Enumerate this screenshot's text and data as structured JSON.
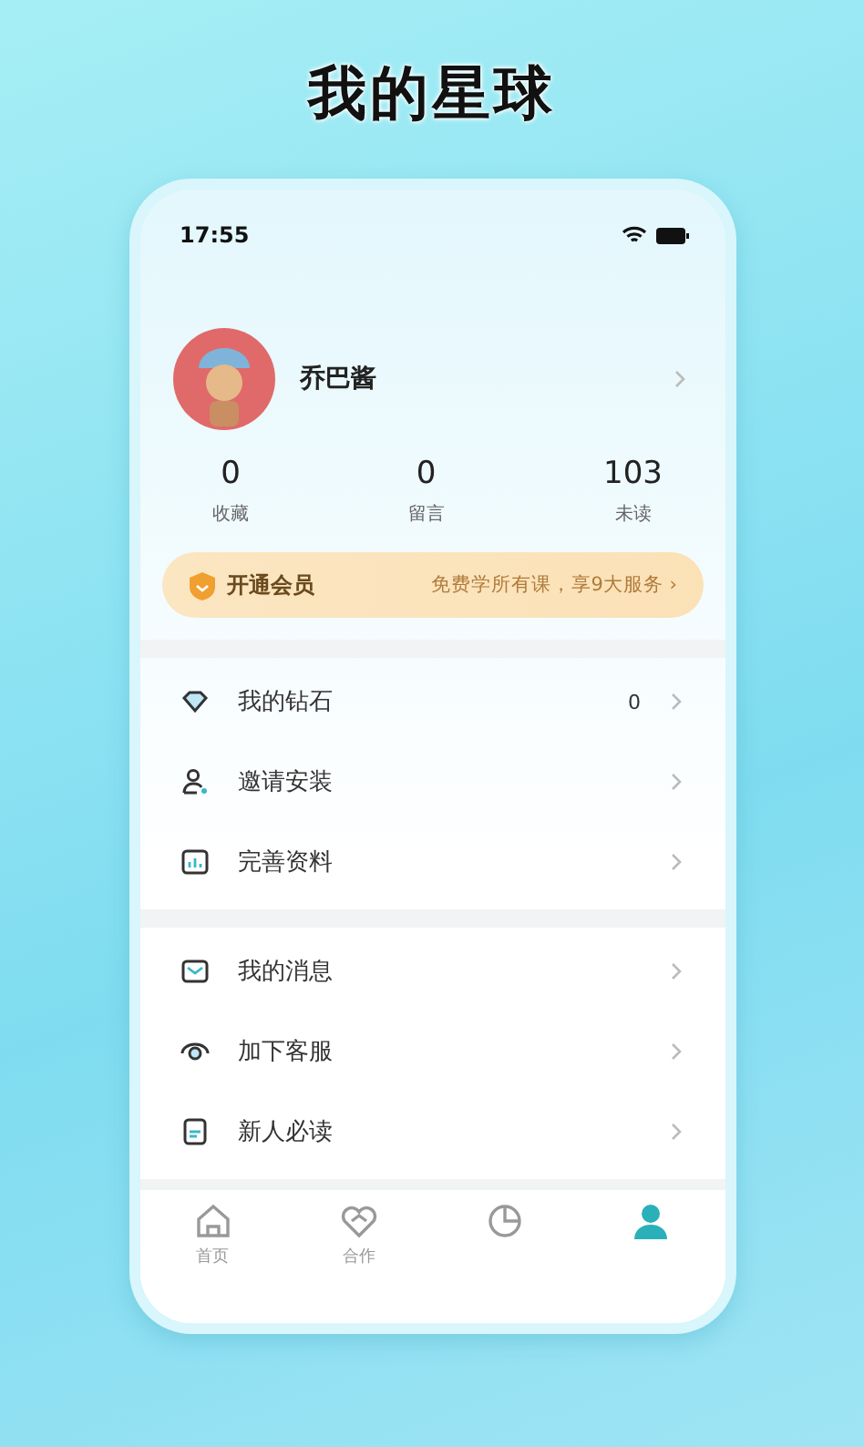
{
  "headline": "我的星球",
  "status_bar": {
    "time": "17:55"
  },
  "profile": {
    "name": "乔巴酱"
  },
  "stats": [
    {
      "value": "0",
      "label": "收藏"
    },
    {
      "value": "0",
      "label": "留言"
    },
    {
      "value": "103",
      "label": "未读"
    }
  ],
  "vip_banner": {
    "title": "开通会员",
    "subtitle": "免费学所有课，享9大服务 ›"
  },
  "menu_groups": [
    {
      "items": [
        {
          "kind": "diamond",
          "label": "我的钻石",
          "value": "0"
        },
        {
          "kind": "invite",
          "label": "邀请安装"
        },
        {
          "kind": "profile",
          "label": "完善资料"
        }
      ]
    },
    {
      "items": [
        {
          "kind": "message",
          "label": "我的消息"
        },
        {
          "kind": "service",
          "label": "加下客服"
        },
        {
          "kind": "guide",
          "label": "新人必读"
        }
      ]
    }
  ],
  "tab_bar": [
    {
      "kind": "home",
      "label": "首页",
      "selected": false
    },
    {
      "kind": "cooperate",
      "label": "合作",
      "selected": false
    },
    {
      "kind": "chart",
      "selected": false
    },
    {
      "kind": "me",
      "selected": true
    }
  ]
}
